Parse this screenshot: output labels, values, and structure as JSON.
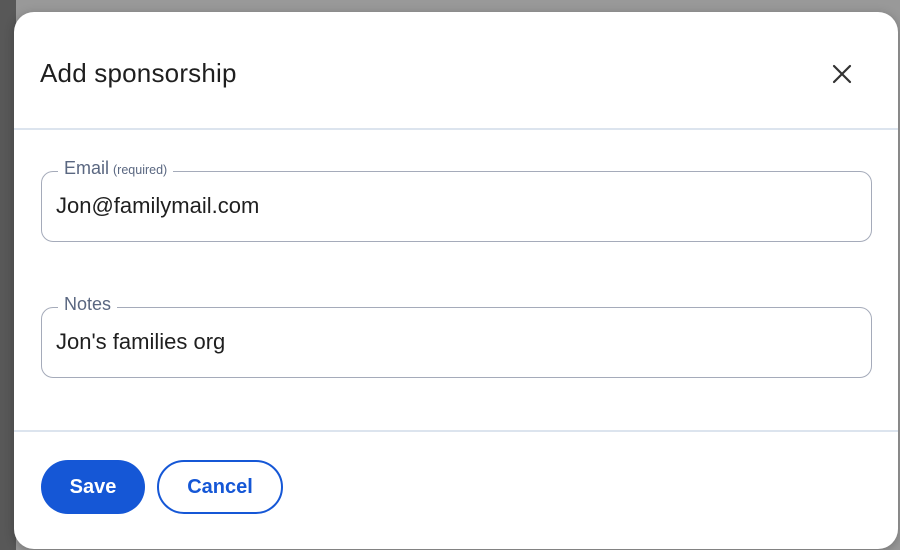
{
  "dialog": {
    "title": "Add sponsorship",
    "close_icon": "close-icon"
  },
  "form": {
    "email": {
      "label": "Email",
      "required_text": "(required)",
      "value": "Jon@familymail.com"
    },
    "notes": {
      "label": "Notes",
      "value": "Jon's families org"
    }
  },
  "footer": {
    "save_label": "Save",
    "cancel_label": "Cancel"
  },
  "colors": {
    "primary": "#1557d6",
    "field_border": "#a5abba",
    "label": "#5a6781",
    "divider": "#dce4ee"
  }
}
